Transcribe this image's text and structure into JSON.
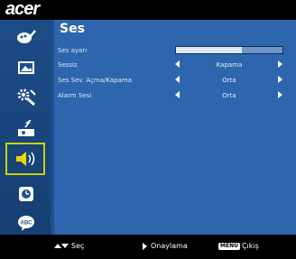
{
  "brand": {
    "logo": "acer"
  },
  "title": "Ses",
  "sidebar": {
    "items": [
      {
        "icon": "palette-brush-icon"
      },
      {
        "icon": "picture-icon"
      },
      {
        "icon": "settings-tools-icon"
      },
      {
        "icon": "projector-icon"
      },
      {
        "icon": "speaker-icon",
        "active": true
      },
      {
        "icon": "clock-icon"
      },
      {
        "icon": "language-abc-icon"
      }
    ]
  },
  "settings": [
    {
      "label": "Ses ayarı",
      "type": "slider",
      "level": 0.62
    },
    {
      "label": "Sessiz",
      "value": "Kapama"
    },
    {
      "label": "Ses Sev. Açma/Kapama",
      "value": "Orta"
    },
    {
      "label": "Alarm Sesi",
      "value": "Orta"
    }
  ],
  "footer": {
    "select": "Seç",
    "confirm": "Onaylama",
    "menu_key": "MENU",
    "exit": "Çıkış"
  },
  "colors": {
    "background": "#1e4f8c",
    "panel": "#2d66ad",
    "active_border": "#c8d200"
  }
}
